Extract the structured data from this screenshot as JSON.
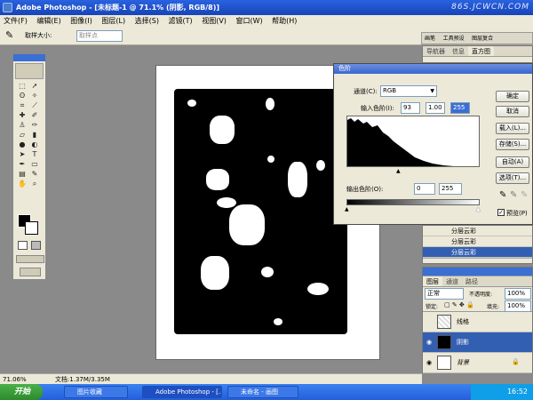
{
  "window": {
    "title": "Adobe Photoshop - [未标题-1 @ 71.1% (阴影, RGB/8)]",
    "watermark": "86S.JCWCN.COM"
  },
  "menu": [
    "文件(F)",
    "编辑(E)",
    "图像(I)",
    "图层(L)",
    "选择(S)",
    "滤镜(T)",
    "视图(V)",
    "窗口(W)",
    "帮助(H)"
  ],
  "options": {
    "sample_label": "取样大小:",
    "sample_value": "取样点",
    "dock_tabs": [
      "画笔",
      "工具预设",
      "图层复合"
    ]
  },
  "status": {
    "zoom": "71.06%",
    "doc": "文档:1.37M/3.35M"
  },
  "taskbar": {
    "start": "开始",
    "tasks": [
      "图片收藏",
      "Adobe Photoshop - [...",
      "未命名 - 画图"
    ],
    "clock": "16:52"
  },
  "levels": {
    "title": "色阶",
    "channel_label": "通道(C):",
    "channel_value": "RGB",
    "input_label": "输入色阶(I):",
    "input_values": [
      "93",
      "1.00",
      "255"
    ],
    "output_label": "输出色阶(O):",
    "output_values": [
      "0",
      "255"
    ],
    "buttons": [
      "确定",
      "取消",
      "载入(L)...",
      "存储(S)...",
      "自动(A)",
      "选项(T)..."
    ],
    "preview_label": "预览(P)",
    "preview_checked": true
  },
  "nav_panel": {
    "tabs": [
      "导航器",
      "信息",
      "直方图"
    ]
  },
  "history_panel": {
    "rows": [
      "分层云彩",
      "分层云彩",
      "分层云彩"
    ]
  },
  "layers_panel": {
    "tabs": [
      "图层",
      "通道",
      "路径"
    ],
    "blend_mode": "正常",
    "opacity_label": "不透明度:",
    "opacity_value": "100%",
    "lock_label": "锁定:",
    "fill_label": "填充:",
    "fill_value": "100%",
    "layers": [
      {
        "name": "线格",
        "selected": false
      },
      {
        "name": "阴影",
        "selected": true
      },
      {
        "name": "背景",
        "selected": false
      }
    ]
  }
}
